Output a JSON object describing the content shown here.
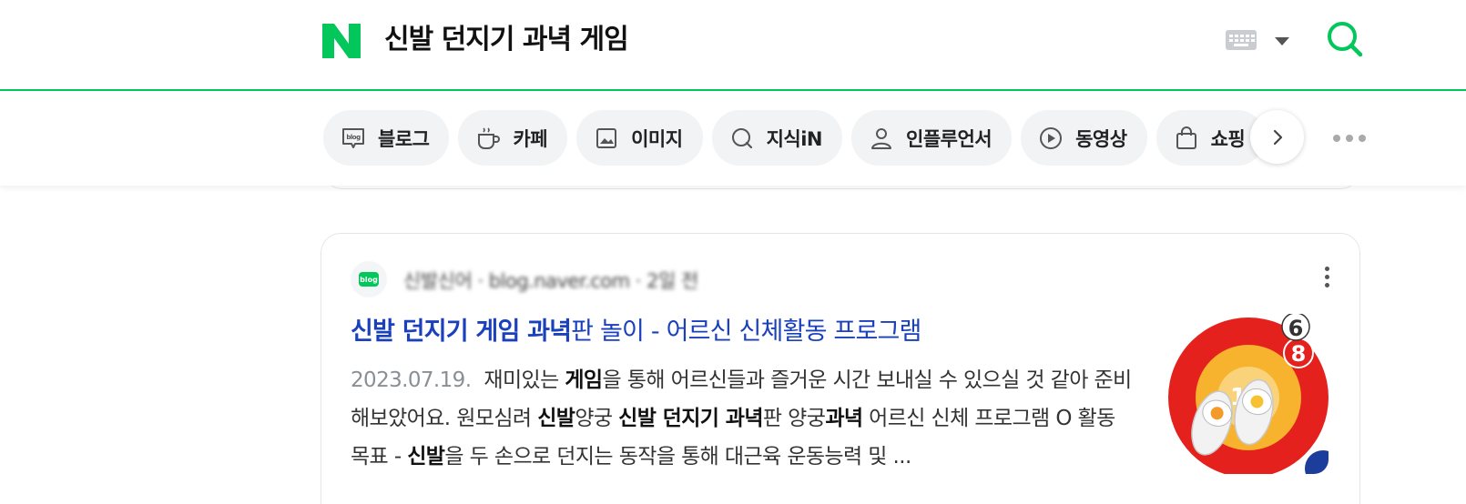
{
  "header": {
    "query": "신발 던지기 과녁 게임",
    "logo_letter": "N"
  },
  "tabs": [
    {
      "label": "블로그",
      "icon": "blog-icon"
    },
    {
      "label": "카페",
      "icon": "cafe-cup-icon"
    },
    {
      "label": "이미지",
      "icon": "image-icon"
    },
    {
      "label": "지식iN",
      "icon": "knowledge-in-icon"
    },
    {
      "label": "인플루언서",
      "icon": "person-icon"
    },
    {
      "label": "동영상",
      "icon": "play-icon"
    },
    {
      "label": "쇼핑",
      "icon": "shopping-bag-icon"
    }
  ],
  "result": {
    "source_icon_text": "blog",
    "source_meta": "신발신어 · blog.naver.com · 2일 전",
    "title_highlight": "신발 던지기 게임 과녁",
    "title_rest": "판 놀이 - 어르신 신체활동 프로그램",
    "date": "2023.07.19.",
    "desc_segments": [
      {
        "t": "재미있는 ",
        "b": false
      },
      {
        "t": "게임",
        "b": true
      },
      {
        "t": "을 통해 어르신들과 즐거운 시간 보내실 수 있으실 것 같아 준비해보았어요. 원모심려 ",
        "b": false
      },
      {
        "t": "신발",
        "b": true
      },
      {
        "t": "양궁 ",
        "b": false
      },
      {
        "t": "신발 던지기 과녁",
        "b": true
      },
      {
        "t": "판 양궁",
        "b": false
      },
      {
        "t": "과녁",
        "b": true
      },
      {
        "t": " 어르신 신체 프로그램 O 활동목표 - ",
        "b": false
      },
      {
        "t": "신발",
        "b": true
      },
      {
        "t": "을 두 손으로 던지는 동작을 통해 대근육 운동능력 및 ...",
        "b": false
      }
    ],
    "thumb_numbers": [
      "6",
      "8",
      "10"
    ]
  },
  "colors": {
    "brand_green": "#03c75a",
    "title_blue": "#1a40bc",
    "date_gray": "#8a8f95"
  }
}
